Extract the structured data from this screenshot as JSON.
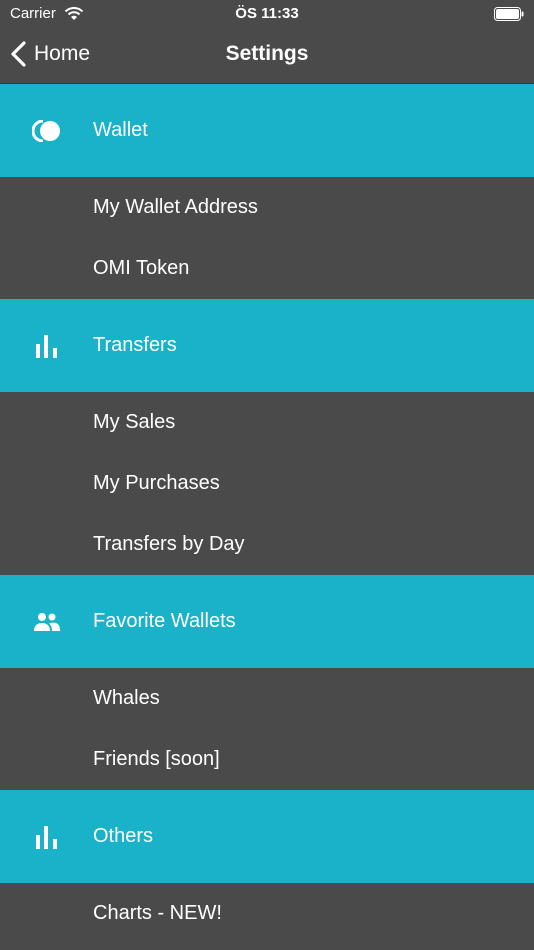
{
  "status": {
    "carrier": "Carrier",
    "time": "ÖS 11:33"
  },
  "nav": {
    "back_label": "Home",
    "title": "Settings"
  },
  "colors": {
    "section_bg": "#19b2c9",
    "page_bg": "#4a4a4a"
  },
  "sections": [
    {
      "title": "Wallet",
      "icon": "toggle-icon",
      "items": [
        "My Wallet Address",
        "OMI Token"
      ]
    },
    {
      "title": "Transfers",
      "icon": "bar-chart-icon",
      "items": [
        "My Sales",
        "My Purchases",
        "Transfers by Day"
      ]
    },
    {
      "title": "Favorite Wallets",
      "icon": "people-icon",
      "items": [
        "Whales",
        "Friends [soon]"
      ]
    },
    {
      "title": "Others",
      "icon": "bar-chart-icon",
      "items": [
        "Charts - NEW!"
      ]
    }
  ]
}
